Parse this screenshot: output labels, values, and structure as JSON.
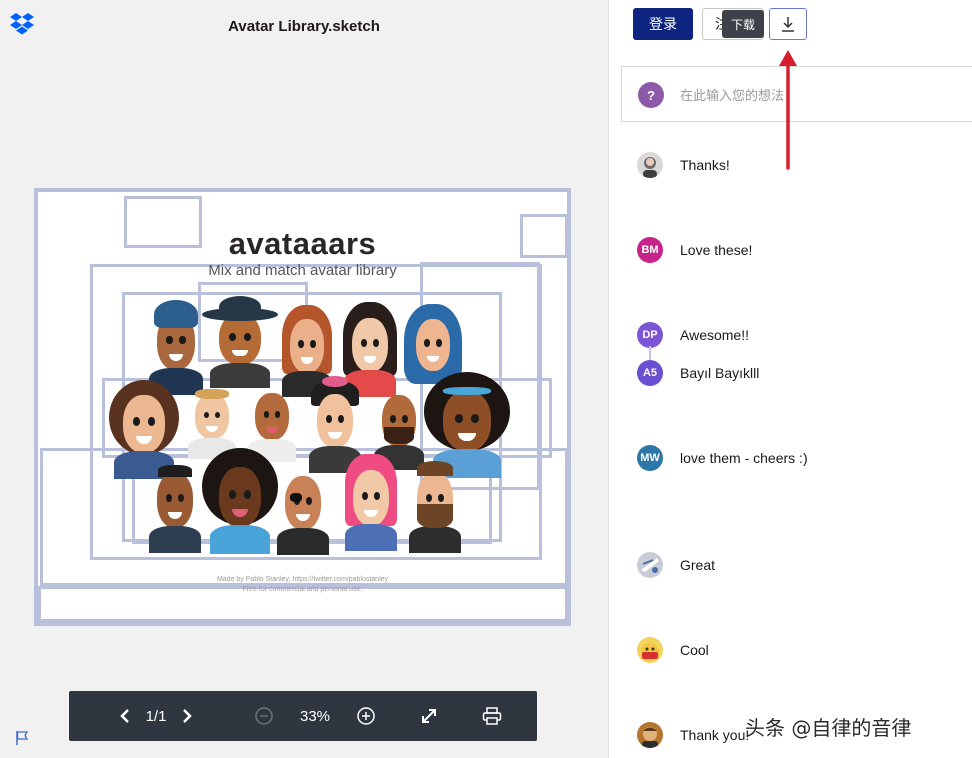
{
  "viewer": {
    "title": "Avatar Library.sketch",
    "preview": {
      "heading": "avataaars",
      "subheading": "Mix and match avatar library",
      "credit": "Made by Pablo Stanley, https://twitter.com/pablostanley",
      "license": "Free for commercial and personal use."
    },
    "toolbar": {
      "page_indicator": "1/1",
      "zoom": "33%",
      "prev_icon": "chevron-left-icon",
      "next_icon": "chevron-right-icon",
      "zoom_out_icon": "zoom-out-icon",
      "zoom_in_icon": "zoom-in-icon",
      "fullscreen_icon": "fullscreen-icon",
      "print_icon": "print-icon"
    }
  },
  "panel": {
    "login_label": "登录",
    "register_label": "注",
    "tooltip": "下载",
    "comment_box": {
      "avatar_text": "?",
      "placeholder": "在此输入您的想法"
    },
    "comments": [
      {
        "initials": "",
        "color": "#d9d9d9",
        "text": "Thanks!"
      },
      {
        "initials": "BM",
        "color": "#c8238a",
        "text": "Love these!"
      },
      {
        "initials": "DP",
        "color": "#7b55d6",
        "text": "Awesome!!"
      },
      {
        "initials": "A5",
        "color": "#6a4fd3",
        "text": "Bayıl Bayıklll"
      },
      {
        "initials": "MW",
        "color": "#2d78a8",
        "text": "love them - cheers :)"
      },
      {
        "initials": "",
        "color": "#c7ccd6",
        "text": "Great"
      },
      {
        "initials": "",
        "color": "#f2d35c",
        "text": "Cool"
      },
      {
        "initials": "",
        "color": "#b5752e",
        "text": "Thank you!"
      }
    ]
  },
  "watermark": "头条 @自律的音律",
  "colors": {
    "brand_blue": "#0d2481",
    "toolbar": "#2f3640",
    "frame": "#b9c0dc",
    "arrow": "#d81e2a"
  }
}
